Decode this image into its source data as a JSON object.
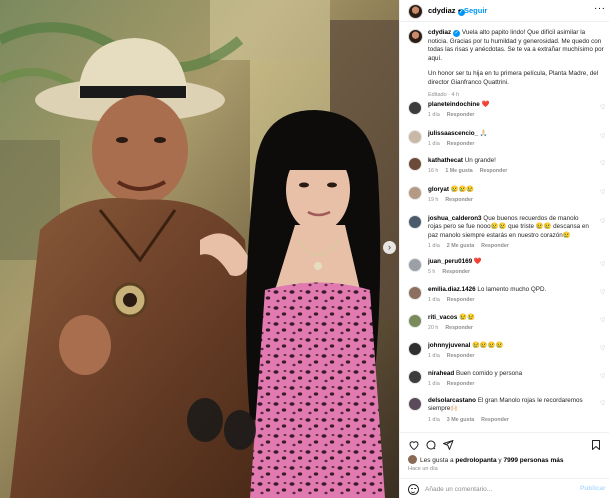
{
  "post": {
    "username": "cdydiaz",
    "separator": "•",
    "follow_label": "Seguir",
    "more_label": "···",
    "next_label": "›"
  },
  "caption": {
    "username": "cdydiaz",
    "text1": "Vuela alto papito lindo! Que difícil asimilar la noticia. Gracias por tu humildad y generosidad. Me quedo con todas las risas y anécdotas. Se te va a extrañar muchísimo por aquí.",
    "text2": "Un honor ser tu hija en tu primera película, Planta Madre, del director Gianfranco Quattrini.",
    "meta": "Editado · 4 h"
  },
  "comments": [
    {
      "user": "planeteindochine",
      "text": "❤️",
      "time": "1 día",
      "likes": "",
      "reply": "Responder",
      "avatar_color": "#3c3c3c"
    },
    {
      "user": "julissaascencio_",
      "text": "🙏🏻",
      "time": "1 día",
      "likes": "",
      "reply": "Responder",
      "avatar_color": "#c9b8a6"
    },
    {
      "user": "kathathecat",
      "text": "Un grande!",
      "time": "16 h",
      "likes": "1 Me gusta",
      "reply": "Responder",
      "avatar_color": "#6b4a3a"
    },
    {
      "user": "gloryat",
      "text": "😢😢😢",
      "time": "19 h",
      "likes": "",
      "reply": "Responder",
      "avatar_color": "#b49a84"
    },
    {
      "user": "joshua_calderon3",
      "text": "Que buenos recuerdos de manolo rojas pero se fue nooo😢😢 que triste 😢😢 descansa en paz manolo siempre estarás en nuestro corazón😢",
      "time": "1 día",
      "likes": "2 Me gusta",
      "reply": "Responder",
      "avatar_color": "#4b5a6a"
    },
    {
      "user": "juan_peru0169",
      "text": "❤️",
      "time": "5 h",
      "likes": "",
      "reply": "Responder",
      "avatar_color": "#9aa0a6"
    },
    {
      "user": "emilia.diaz.1426",
      "text": "Lo lamento mucho QPD.",
      "time": "1 día",
      "likes": "",
      "reply": "Responder",
      "avatar_color": "#8c6f60"
    },
    {
      "user": "riti_vacos",
      "text": "😢😢",
      "time": "20 h",
      "likes": "",
      "reply": "Responder",
      "avatar_color": "#7a8a5a"
    },
    {
      "user": "johnnyjuvenal",
      "text": "😢😢😢😢",
      "time": "1 día",
      "likes": "",
      "reply": "Responder",
      "avatar_color": "#2f2f2f"
    },
    {
      "user": "nirahead",
      "text": "Buen comido y persona",
      "time": "1 día",
      "likes": "",
      "reply": "Responder",
      "avatar_color": "#3d3d3d"
    },
    {
      "user": "delsolarcastano",
      "text": "El gran Manolo rojas le recordaremos siempre🙌🏻",
      "time": "1 día",
      "likes": "3 Me gusta",
      "reply": "Responder",
      "avatar_color": "#5a4a5a"
    }
  ],
  "likes_summary": {
    "prefix": "Les gusta a",
    "user": "pedrolopanta",
    "middle": "y",
    "count": "7999 personas más"
  },
  "posted_time": "Hace un día",
  "add_comment": {
    "placeholder": "Añade un comentario...",
    "publish_label": "Publicar"
  },
  "colors": {
    "accent": "#0095f6",
    "publish_disabled": "#b3dbff",
    "like_red": "#ed4956"
  }
}
